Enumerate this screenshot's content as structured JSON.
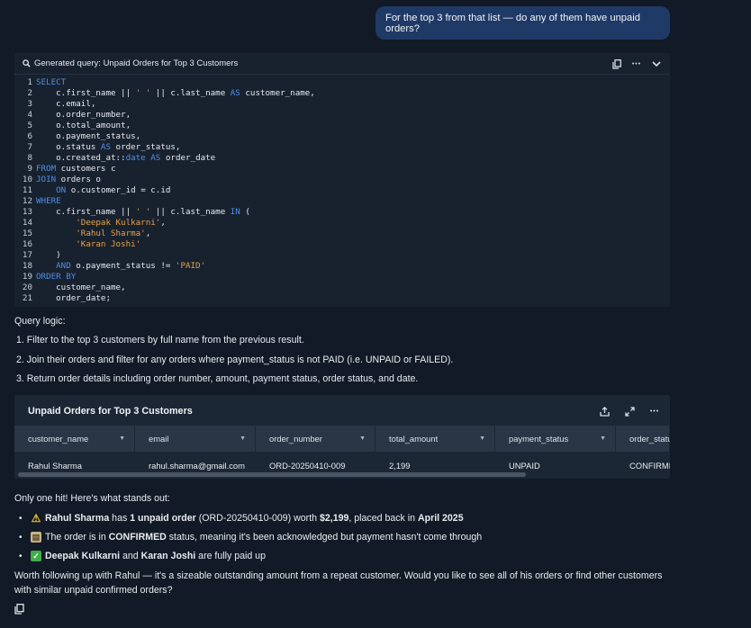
{
  "user_message": "For the top 3 from that list — do any of them have unpaid orders?",
  "query_panel": {
    "title": "Generated query: Unpaid Orders for Top 3 Customers",
    "icons": [
      "search-icon",
      "copy-icon",
      "more-icon",
      "chevron-down-icon"
    ],
    "more_glyph": "•••",
    "lines": [
      {
        "n": "1",
        "segs": [
          {
            "t": "SELECT",
            "c": "kw"
          }
        ]
      },
      {
        "n": "2",
        "segs": [
          {
            "t": "    c.first_name || ",
            "c": "tx"
          },
          {
            "t": "' '",
            "c": "st"
          },
          {
            "t": " || c.last_name ",
            "c": "tx"
          },
          {
            "t": "AS",
            "c": "kw"
          },
          {
            "t": " customer_name,",
            "c": "tx"
          }
        ]
      },
      {
        "n": "3",
        "segs": [
          {
            "t": "    c.email,",
            "c": "tx"
          }
        ]
      },
      {
        "n": "4",
        "segs": [
          {
            "t": "    o.order_number,",
            "c": "tx"
          }
        ]
      },
      {
        "n": "5",
        "segs": [
          {
            "t": "    o.total_amount,",
            "c": "tx"
          }
        ]
      },
      {
        "n": "6",
        "segs": [
          {
            "t": "    o.payment_status,",
            "c": "tx"
          }
        ]
      },
      {
        "n": "7",
        "segs": [
          {
            "t": "    o.status ",
            "c": "tx"
          },
          {
            "t": "AS",
            "c": "kw"
          },
          {
            "t": " order_status,",
            "c": "tx"
          }
        ]
      },
      {
        "n": "8",
        "segs": [
          {
            "t": "    o.created_at::",
            "c": "tx"
          },
          {
            "t": "date",
            "c": "kw"
          },
          {
            "t": " ",
            "c": "tx"
          },
          {
            "t": "AS",
            "c": "kw"
          },
          {
            "t": " order_date",
            "c": "tx"
          }
        ]
      },
      {
        "n": "9",
        "segs": [
          {
            "t": "FROM",
            "c": "kw"
          },
          {
            "t": " customers c",
            "c": "tx"
          }
        ]
      },
      {
        "n": "10",
        "segs": [
          {
            "t": "JOIN",
            "c": "kw"
          },
          {
            "t": " orders o",
            "c": "tx"
          }
        ]
      },
      {
        "n": "11",
        "segs": [
          {
            "t": "    ",
            "c": "tx"
          },
          {
            "t": "ON",
            "c": "kw"
          },
          {
            "t": " o.customer_id = c.id",
            "c": "tx"
          }
        ]
      },
      {
        "n": "12",
        "segs": [
          {
            "t": "WHERE",
            "c": "kw"
          }
        ]
      },
      {
        "n": "13",
        "segs": [
          {
            "t": "    c.first_name || ",
            "c": "tx"
          },
          {
            "t": "' '",
            "c": "st"
          },
          {
            "t": " || c.last_name ",
            "c": "tx"
          },
          {
            "t": "IN",
            "c": "kw"
          },
          {
            "t": " (",
            "c": "tx"
          }
        ]
      },
      {
        "n": "14",
        "segs": [
          {
            "t": "        ",
            "c": "tx"
          },
          {
            "t": "'Deepak Kulkarni'",
            "c": "st"
          },
          {
            "t": ",",
            "c": "tx"
          }
        ]
      },
      {
        "n": "15",
        "segs": [
          {
            "t": "        ",
            "c": "tx"
          },
          {
            "t": "'Rahul Sharma'",
            "c": "st"
          },
          {
            "t": ",",
            "c": "tx"
          }
        ]
      },
      {
        "n": "16",
        "segs": [
          {
            "t": "        ",
            "c": "tx"
          },
          {
            "t": "'Karan Joshi'",
            "c": "st"
          }
        ]
      },
      {
        "n": "17",
        "segs": [
          {
            "t": "    )",
            "c": "tx"
          }
        ]
      },
      {
        "n": "18",
        "segs": [
          {
            "t": "    ",
            "c": "tx"
          },
          {
            "t": "AND",
            "c": "kw"
          },
          {
            "t": " o.payment_status != ",
            "c": "tx"
          },
          {
            "t": "'PAID'",
            "c": "st"
          }
        ]
      },
      {
        "n": "19",
        "segs": [
          {
            "t": "ORDER BY",
            "c": "kw"
          }
        ]
      },
      {
        "n": "20",
        "segs": [
          {
            "t": "    customer_name,",
            "c": "tx"
          }
        ]
      },
      {
        "n": "21",
        "segs": [
          {
            "t": "    order_date;",
            "c": "tx"
          }
        ]
      }
    ]
  },
  "logic": {
    "heading": "Query logic:",
    "steps": [
      "1. Filter to the top 3 customers by full name from the previous result.",
      "2. Join their orders and filter for any orders where payment_status is not PAID (i.e. UNPAID or FAILED).",
      "3. Return order details including order number, amount, payment status, order status, and date."
    ]
  },
  "table": {
    "title": "Unpaid Orders for Top 3 Customers",
    "icons": [
      "share-icon",
      "expand-icon",
      "more-icon"
    ],
    "more_glyph": "•••",
    "columns": [
      {
        "label": "customer_name",
        "w": 134
      },
      {
        "label": "email",
        "w": 134
      },
      {
        "label": "order_number",
        "w": 133
      },
      {
        "label": "total_amount",
        "w": 133
      },
      {
        "label": "payment_status",
        "w": 134
      },
      {
        "label": "order_status",
        "w": 60
      }
    ],
    "rows": [
      [
        "Rahul Sharma",
        "rahul.sharma@gmail.com",
        "ORD-20250410-009",
        "2,199",
        "UNPAID",
        "CONFIRMED"
      ]
    ]
  },
  "answer": {
    "intro": "Only one hit! Here's what stands out:",
    "bullet_char": "•",
    "bullets": [
      {
        "icon": "warning-icon",
        "glyph": "⚠",
        "parts": [
          {
            "t": "Rahul Sharma",
            "b": true
          },
          {
            "t": " has ",
            "b": false
          },
          {
            "t": "1 unpaid order",
            "b": true
          },
          {
            "t": " (ORD-20250410-009) worth ",
            "b": false
          },
          {
            "t": "$2,199",
            "b": true
          },
          {
            "t": ", placed back in ",
            "b": false
          },
          {
            "t": "April 2025",
            "b": true
          }
        ]
      },
      {
        "icon": "clipboard-icon",
        "glyph": "▤",
        "parts": [
          {
            "t": "The order is in ",
            "b": false
          },
          {
            "t": "CONFIRMED",
            "b": true
          },
          {
            "t": " status, meaning it's been acknowledged but payment hasn't come through",
            "b": false
          }
        ]
      },
      {
        "icon": "check-icon",
        "glyph": "✓",
        "parts": [
          {
            "t": "Deepak Kulkarni",
            "b": true
          },
          {
            "t": " and ",
            "b": false
          },
          {
            "t": "Karan Joshi",
            "b": true
          },
          {
            "t": " are fully paid up",
            "b": false
          }
        ]
      }
    ],
    "closing_line1": "Worth following up with Rahul — it's a sizeable outstanding amount from a repeat customer. Would you like to see all of his orders or find other customers",
    "closing_line2": "with similar unpaid confirmed orders?"
  },
  "colors": {
    "bg": "#111a26",
    "user_bubble": "#1f3a66",
    "keyword": "#4d8ee8",
    "string": "#e8a045"
  }
}
